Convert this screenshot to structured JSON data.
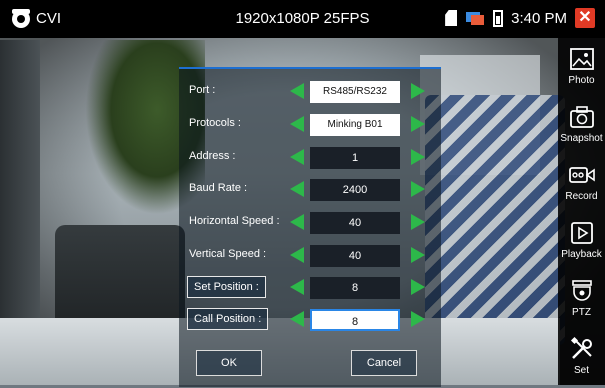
{
  "status_bar": {
    "app_name": "CVI",
    "resolution": "1920x1080P 25FPS",
    "time": "3:40 PM"
  },
  "sidebar": {
    "items": [
      {
        "label": "Photo",
        "icon": "photo-icon"
      },
      {
        "label": "Snapshot",
        "icon": "camera-icon"
      },
      {
        "label": "Record",
        "icon": "video-record-icon"
      },
      {
        "label": "Playback",
        "icon": "play-icon"
      },
      {
        "label": "PTZ",
        "icon": "ptz-dome-icon"
      },
      {
        "label": "Set",
        "icon": "tools-icon"
      }
    ]
  },
  "dialog": {
    "rows": [
      {
        "label": "Port :",
        "value": "RS485/RS232"
      },
      {
        "label": "Protocols :",
        "value": "Minking B01"
      },
      {
        "label": "Address :",
        "value": "1"
      },
      {
        "label": "Baud Rate :",
        "value": "2400"
      },
      {
        "label": "Horizontal Speed :",
        "value": "40"
      },
      {
        "label": "Vertical Speed :",
        "value": "40"
      },
      {
        "label": "Set Position :",
        "value": "8"
      },
      {
        "label": "Call Position :",
        "value": "8"
      }
    ],
    "ok_label": "OK",
    "cancel_label": "Cancel"
  },
  "colors": {
    "accent_blue": "#1d6fd1",
    "arrow_green": "#2db84a",
    "close_red": "#e03a25"
  }
}
